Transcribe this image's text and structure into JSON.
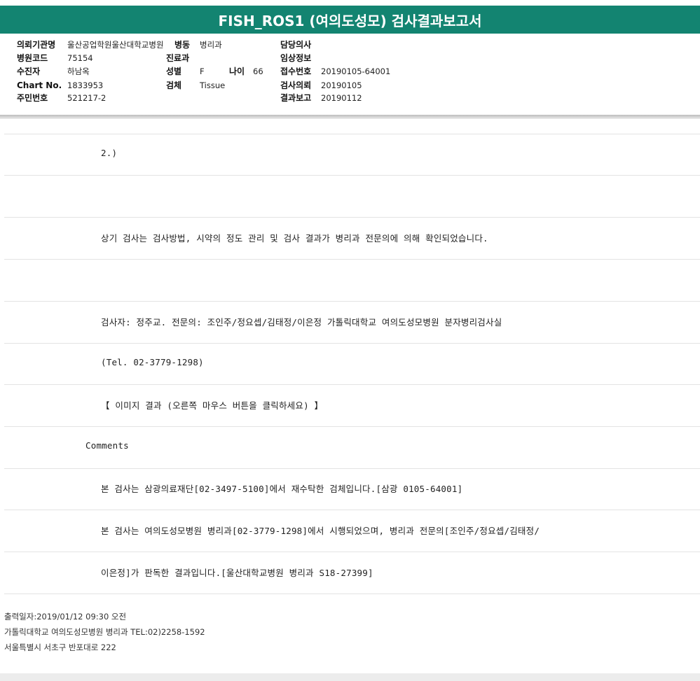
{
  "report": {
    "title": "FISH_ROS1 (여의도성모) 검사결과보고서"
  },
  "header": {
    "institution_label": "의뢰기관명",
    "institution_value": "울산공업학원울산대학교병원",
    "ward_label": "병동",
    "ward_value": "병리과",
    "doctor_label": "담당의사",
    "doctor_value": "",
    "hospital_code_label": "병원코드",
    "hospital_code_value": "75154",
    "dept_label": "진료과",
    "dept_value": "",
    "clinical_label": "임상정보",
    "clinical_value": "",
    "patient_label": "수진자",
    "patient_value": "하남옥",
    "sex_label": "성별",
    "sex_value": "F",
    "age_label": "나이",
    "age_value": "66",
    "receipt_label": "접수번호",
    "receipt_value": "20190105-64001",
    "chart_label": "Chart No.",
    "chart_value": "1833953",
    "specimen_label": "검체",
    "specimen_value": "Tissue",
    "request_label": "검사의뢰",
    "request_value": "20190105",
    "resident_label": "주민번호",
    "resident_value": "521217-2",
    "result_label": "결과보고",
    "result_value": "20190112"
  },
  "body": {
    "line_1": "2.)",
    "line_2": "상기 검사는 검사방법, 시약의 정도 관리 및 검사 결과가 병리과 전문의에 의해 확인되었습니다.",
    "line_3": "검사자: 정주교.  전문의: 조인주/정요셉/김태정/이은정 가톨릭대학교 여의도성모병원 분자병리검사실",
    "line_4": "(Tel. 02-3779-1298)",
    "line_5": "【 이미지 결과 (오른쪽 마우스 버튼을 클릭하세요) 】",
    "comments_label": "Comments",
    "line_6": "본 검사는 삼광의료재단[02-3497-5100]에서 재수탁한 검체입니다.[삼광 0105-64001]",
    "line_7": "본 검사는 여의도성모병원 병리과[02-3779-1298]에서 시행되었으며, 병리과 전문의[조인주/정요셉/김태정/",
    "line_8": "이은정]가 판독한 결과입니다.[울산대학교병원 병리과 S18-27399]"
  },
  "footer": {
    "printed": "출력일자:2019/01/12 09:30 오전",
    "hospital": "가톨릭대학교 여의도성모병원 병리과 TEL:02)2258-1592",
    "address": "서울특별시 서초구 반포대로 222"
  },
  "colors": {
    "title_bar": "#138471",
    "divider": "#e3e3e3"
  }
}
